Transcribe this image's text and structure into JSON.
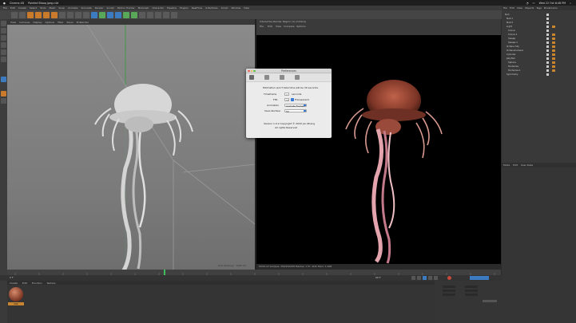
{
  "menubar": {
    "app": "Cinema 4D",
    "window_title": "Pointed Bloop.jpeg.c4d",
    "items": [
      "File",
      "Edit",
      "Create",
      "Select",
      "Tools",
      "Mesh",
      "Snap",
      "Animate",
      "Simulate",
      "Render",
      "Sculpt",
      "Motion Tracker",
      "MoGraph",
      "Character",
      "Pipeline",
      "Plugins",
      "RealFlow",
      "X-Particles",
      "Script",
      "Window",
      "Help"
    ],
    "clock": "Wed 22 Oct 6:48 PM"
  },
  "viewport": {
    "menu": [
      "View",
      "Cameras",
      "Display",
      "Options",
      "Filter",
      "Panel",
      "ProRender"
    ],
    "grid_label": "Grid Spacing : 1000 cm"
  },
  "render_view": {
    "title": "Interactive Render Region (1) (Octane)",
    "menu": [
      "File",
      "Edit",
      "View",
      "Compare",
      "Options"
    ],
    "status": "00:00:12  Samples: 256/256/256  Meshes: 1  Tri: 412k  Mem: 1.2GB"
  },
  "dialog": {
    "title": "Preferences",
    "message": "Estimation won't take time will be 30 seconds.",
    "rows": [
      {
        "label": "Timeframe",
        "value": "2",
        "unit": "seconds"
      },
      {
        "label": "FPS",
        "value": "30",
        "check_label": "Transparent"
      },
      {
        "label": "Animation",
        "value": "Animate Frames"
      },
      {
        "label": "Save Number",
        "value": "50"
      }
    ],
    "version": "Version 1.0.2 Copyright © 2020 Jun Zhang",
    "rights": "All rights Reserved"
  },
  "object_manager": {
    "tabs": [
      "File",
      "Edit",
      "View",
      "Objects",
      "Tags",
      "Bookmarks"
    ],
    "objects": [
      "Null",
      "Null.1",
      "Null.2",
      "Light",
      "Cloner",
      "Cloner.1",
      "Sweep",
      "Sweep.1",
      "Octane Sky",
      "OctaneCamera",
      "Cylinder",
      "Jellyfish",
      "Sphere",
      "Tentacles",
      "Tentacles.1",
      "Symmetry"
    ]
  },
  "attributes": {
    "tabs": [
      "Mode",
      "Edit",
      "User Data"
    ]
  },
  "material_manager": {
    "tabs": [
      "Create",
      "Edit",
      "Function",
      "Texture"
    ],
    "material_name": "Mat"
  },
  "timeline": {
    "start": "0 F",
    "end": "90 F"
  }
}
